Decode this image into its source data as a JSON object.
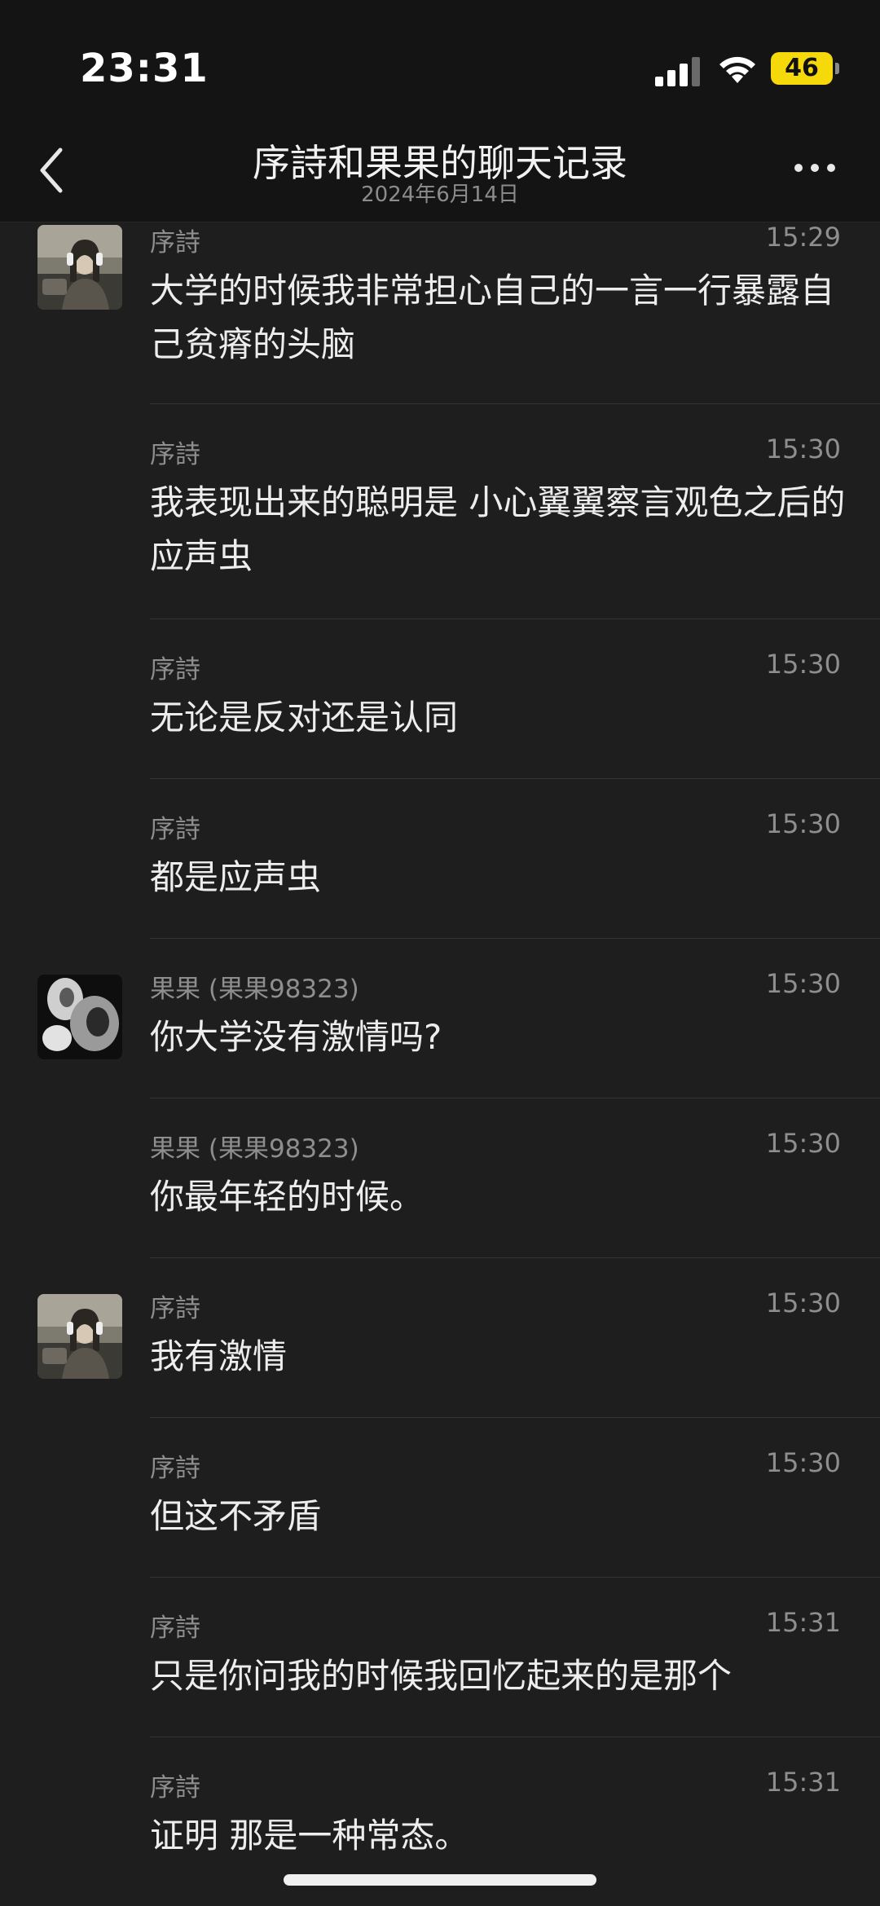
{
  "status_bar": {
    "time": "23:31",
    "battery": "46"
  },
  "nav": {
    "title": "序詩和果果的聊天记录",
    "date": "2024年6月14日"
  },
  "messages": [
    {
      "sender": "序詩",
      "time": "15:29",
      "text": "大学的时候我非常担心自己的一言一行暴露自己贫瘠的头脑",
      "avatar": "avatar-xushi"
    },
    {
      "sender": "序詩",
      "time": "15:30",
      "text": "我表现出来的聪明是 小心翼翼察言观色之后的应声虫"
    },
    {
      "sender": "序詩",
      "time": "15:30",
      "text": "无论是反对还是认同"
    },
    {
      "sender": "序詩",
      "time": "15:30",
      "text": "都是应声虫"
    },
    {
      "sender": "果果 (果果98323)",
      "time": "15:30",
      "text": "你大学没有激情吗?",
      "avatar": "avatar-guoguo"
    },
    {
      "sender": "果果 (果果98323)",
      "time": "15:30",
      "text": "你最年轻的时候。"
    },
    {
      "sender": "序詩",
      "time": "15:30",
      "text": "我有激情",
      "avatar": "avatar-xushi"
    },
    {
      "sender": "序詩",
      "time": "15:30",
      "text": "但这不矛盾"
    },
    {
      "sender": "序詩",
      "time": "15:31",
      "text": "只是你问我的时候我回忆起来的是那个"
    },
    {
      "sender": "序詩",
      "time": "15:31",
      "text": "证明 那是一种常态。"
    }
  ]
}
